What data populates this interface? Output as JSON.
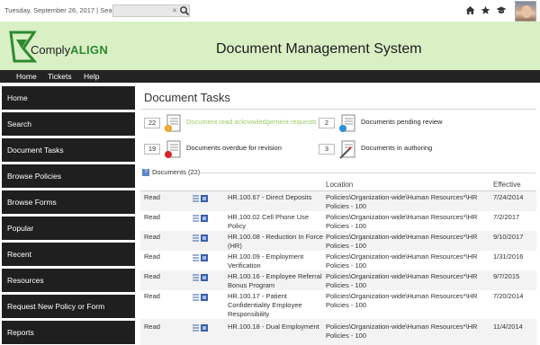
{
  "topbar": {
    "date": "Tuesday, September 26, 2017",
    "separator": "|",
    "search_label": "Search",
    "search_placeholder": "",
    "icons": [
      "home-icon",
      "star-icon",
      "graduation-cap-icon"
    ]
  },
  "banner": {
    "brand_prefix": "Comply",
    "brand_suffix": "ALIGN",
    "title": "Document Management System"
  },
  "navbar": {
    "items": [
      "Home",
      "Tickets",
      "Help"
    ]
  },
  "sidebar": {
    "items": [
      "Home",
      "Search",
      "Document Tasks",
      "Browse Policies",
      "Browse Forms",
      "Popular",
      "Recent",
      "Resources",
      "Request New Policy or Form",
      "Reports"
    ]
  },
  "main": {
    "title": "Document Tasks",
    "tasks": [
      {
        "count": "22",
        "label": "Document read acknowledgement requests"
      },
      {
        "count": "2",
        "label": "Documents pending review"
      },
      {
        "count": "19",
        "label": "Documents overdue for revision"
      },
      {
        "count": "3",
        "label": "Documents in authoring"
      }
    ],
    "documents_heading": "Documents (22)",
    "columns": {
      "location": "Location",
      "effective": "Effective"
    },
    "rows": [
      {
        "action": "Read",
        "title": [
          "HR.100.67 - Direct Deposits"
        ],
        "location": [
          "Policies\\Organization-wide\\Human Resources*\\HR",
          "Policies - 100"
        ],
        "effective": "7/24/2014"
      },
      {
        "action": "Read",
        "title": [
          "HR.100.02 Cell Phone Use",
          "Policy"
        ],
        "location": [
          "Policies\\Organization-wide\\Human Resources*\\HR",
          "Policies - 100"
        ],
        "effective": "7/2/2017"
      },
      {
        "action": "Read",
        "title": [
          "HR.100.08 - Reduction In Force",
          "(HR)"
        ],
        "location": [
          "Policies\\Organization-wide\\Human Resources*\\HR",
          "Policies - 100"
        ],
        "effective": "9/10/2017"
      },
      {
        "action": "Read",
        "title": [
          "HR.100.09 - Employment",
          "Verification"
        ],
        "location": [
          "Policies\\Organization-wide\\Human Resources*\\HR",
          "Policies - 100"
        ],
        "effective": "1/31/2016"
      },
      {
        "action": "Read",
        "title": [
          "HR.100.16 - Employee Referral",
          "Bonus Program"
        ],
        "location": [
          "Policies\\Organization-wide\\Human Resources*\\HR",
          "Policies - 100"
        ],
        "effective": "9/7/2015"
      },
      {
        "action": "Read",
        "title": [
          "HR.100.17 - Patient",
          "Confidentiality Employee",
          "Responsibility"
        ],
        "location": [
          "Policies\\Organization-wide\\Human Resources*\\HR",
          "Policies - 100"
        ],
        "effective": "7/20/2014"
      },
      {
        "action": "Read",
        "title": [
          "HR.100.18 - Dual Employment"
        ],
        "location": [
          "Policies\\Organization-wide\\Human Resources*\\HR",
          "Policies - 100"
        ],
        "effective": "11/4/2014"
      }
    ]
  },
  "colors": {
    "banner": "#d9efc4",
    "nav": "#232323",
    "sidebar_item": "#1f1f1f",
    "brand_green": "#2f8a2f",
    "dim_task": "#9ccc65"
  }
}
